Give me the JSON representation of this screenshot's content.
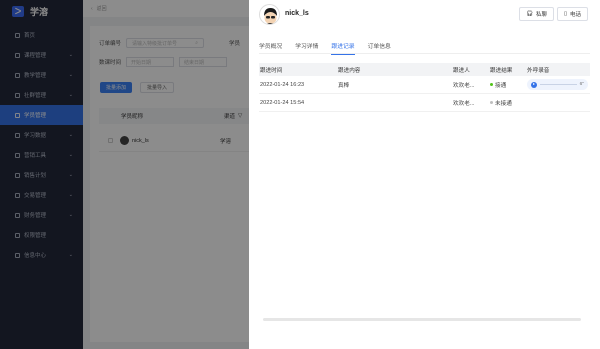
{
  "sidebar": {
    "logo_text": "学溶",
    "items": [
      {
        "label": "首页",
        "arrow": ""
      },
      {
        "label": "课程管理",
        "arrow": "⌄"
      },
      {
        "label": "教学管理",
        "arrow": "⌄"
      },
      {
        "label": "社群管理",
        "arrow": "⌄"
      },
      {
        "label": "学员管理",
        "arrow": ""
      },
      {
        "label": "学习数据",
        "arrow": "⌄"
      },
      {
        "label": "营销工具",
        "arrow": "⌄"
      },
      {
        "label": "销售计划",
        "arrow": "⌄"
      },
      {
        "label": "交易管理",
        "arrow": "⌄"
      },
      {
        "label": "财务管理",
        "arrow": "⌄"
      },
      {
        "label": "权限管理",
        "arrow": ""
      },
      {
        "label": "信息中心",
        "arrow": "⌄"
      }
    ],
    "active_index": 4
  },
  "main": {
    "back_label": "返回",
    "order_no_label": "订单编号",
    "order_no_placeholder": "请输入特级批订单号",
    "follow_time_label": "数课时间",
    "start_date": "开始日期",
    "end_date": "结束日期",
    "btn_primary": "批量添加",
    "btn_secondary": "批量导入",
    "col_name": "学员昵称",
    "col_channel": "渠道",
    "row_name": "nick_ls",
    "row_channel": "学溶",
    "label_trunc": "学员"
  },
  "drawer": {
    "username": "nick_ls",
    "chat_label": "私聊",
    "phone_label": "电话",
    "tabs": [
      "学员概况",
      "学习详情",
      "跟进记录",
      "订单信息"
    ],
    "active_tab": 2,
    "columns": [
      "跟进时间",
      "跟进内容",
      "跟进人",
      "跟进结果",
      "外呼录音"
    ],
    "rows": [
      {
        "time": "2022-01-24 16:23",
        "content": "真棒",
        "person": "欢欢老...",
        "result": "接通",
        "result_color": "#52c41a",
        "audio_duration": "6\""
      },
      {
        "time": "2022-01-24 15:54",
        "content": "",
        "person": "欢欢老...",
        "result": "未接通",
        "result_color": "#bfbfbf",
        "audio_duration": ""
      }
    ]
  },
  "colors": {
    "accent": "#3573e8",
    "sidebar_bg": "#24293b"
  }
}
